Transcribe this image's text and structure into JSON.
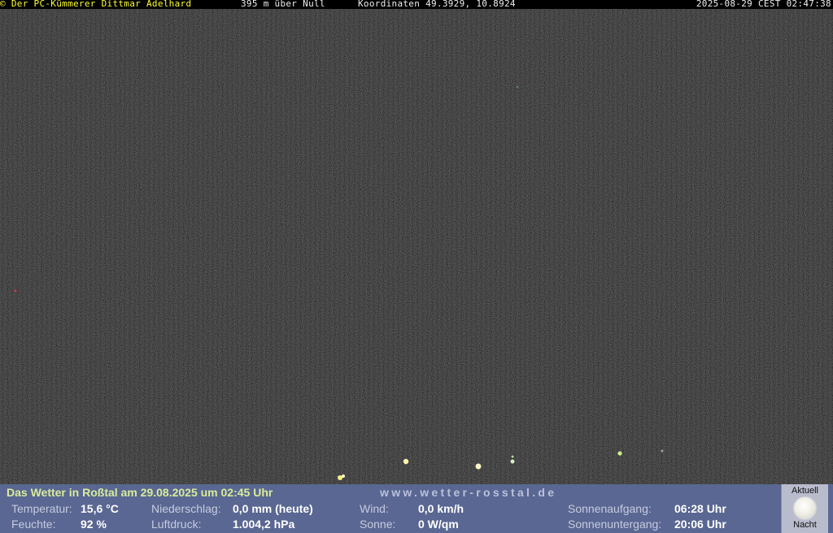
{
  "overlay": {
    "copyright": "© Der PC-Kümmerer Dittmar Adelhard",
    "altitude": "395 m über Null",
    "coordinates": "Koordinaten 49.3929, 10.8924",
    "timestamp": "2025-08-29 CEST 02:47:38"
  },
  "weather": {
    "title": "Das Wetter in Roßtal am 29.08.2025 um 02:45 Uhr",
    "url": "www.wetter-rosstal.de",
    "temperature_label": "Temperatur:",
    "temperature_value": "15,6 °C",
    "humidity_label": "Feuchte:",
    "humidity_value": "92 %",
    "precip_label": "Niederschlag:",
    "precip_value": "0,0 mm (heute)",
    "pressure_label": "Luftdruck:",
    "pressure_value": "1.004,2 hPa",
    "wind_label": "Wind:",
    "wind_value": "0,0 km/h",
    "sun_label": "Sonne:",
    "sun_value": "0 W/qm",
    "sunrise_label": "Sonnenaufgang:",
    "sunrise_value": "06:28 Uhr",
    "sunset_label": "Sonnenuntergang:",
    "sunset_value": "20:06 Uhr"
  },
  "moon": {
    "label_top": "Aktuell",
    "label_bottom": "Nacht",
    "icon": "full-moon-icon"
  },
  "colors": {
    "weather_bar": "#5a6792",
    "title": "#d8ec9a",
    "copyright": "#ffff33"
  }
}
